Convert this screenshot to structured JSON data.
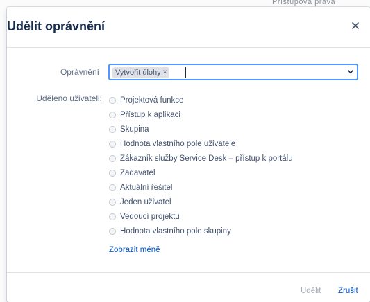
{
  "background": {
    "partial_text": "Přístupová práva"
  },
  "dialog": {
    "title": "Udělit oprávnění",
    "close_icon": "close-icon"
  },
  "permission": {
    "label": "Oprávnění",
    "tag": "Vytvořit úlohy",
    "tag_remove": "×",
    "dropdown_icon": "chevron-down-icon"
  },
  "granted": {
    "label": "Uděleno uživateli:",
    "options": [
      "Projektová funkce",
      "Přístup k aplikaci",
      "Skupina",
      "Hodnota vlastního pole uživatele",
      "Zákazník služby Service Desk – přístup k portálu",
      "Zadavatel",
      "Aktuální řešitel",
      "Jeden uživatel",
      "Vedoucí projektu",
      "Hodnota vlastního pole skupiny"
    ],
    "show_less": "Zobrazit méně"
  },
  "footer": {
    "grant_label": "Udělit",
    "cancel_label": "Zrušit"
  },
  "colors": {
    "accent": "#0052cc",
    "focus_border": "#4c9aff",
    "disabled_text": "#a5adba"
  }
}
